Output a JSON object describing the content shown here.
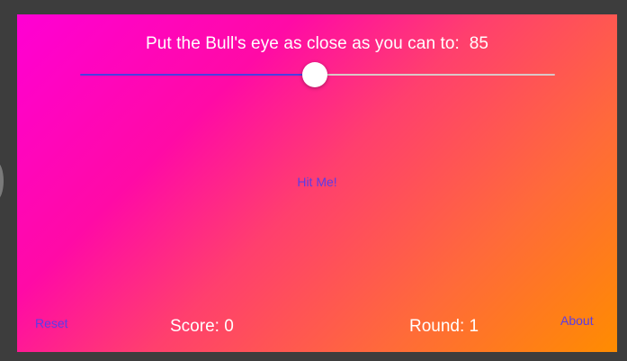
{
  "game": {
    "instruction": "Put the Bull's eye as close as you can to:",
    "target_value": "85",
    "slider_value": 50,
    "slider_min": 1,
    "slider_max": 100,
    "hit_label": "Hit Me!",
    "reset_label": "Reset",
    "score_text": "Score: 0",
    "round_text": "Round: 1",
    "about_label": "About"
  },
  "colors": {
    "accent": "#5a3ce8",
    "track_filled": "#4a3fe0",
    "track_empty": "#d9c7c7",
    "gradient_start": "#ff00d4",
    "gradient_end": "#ff8c00"
  }
}
